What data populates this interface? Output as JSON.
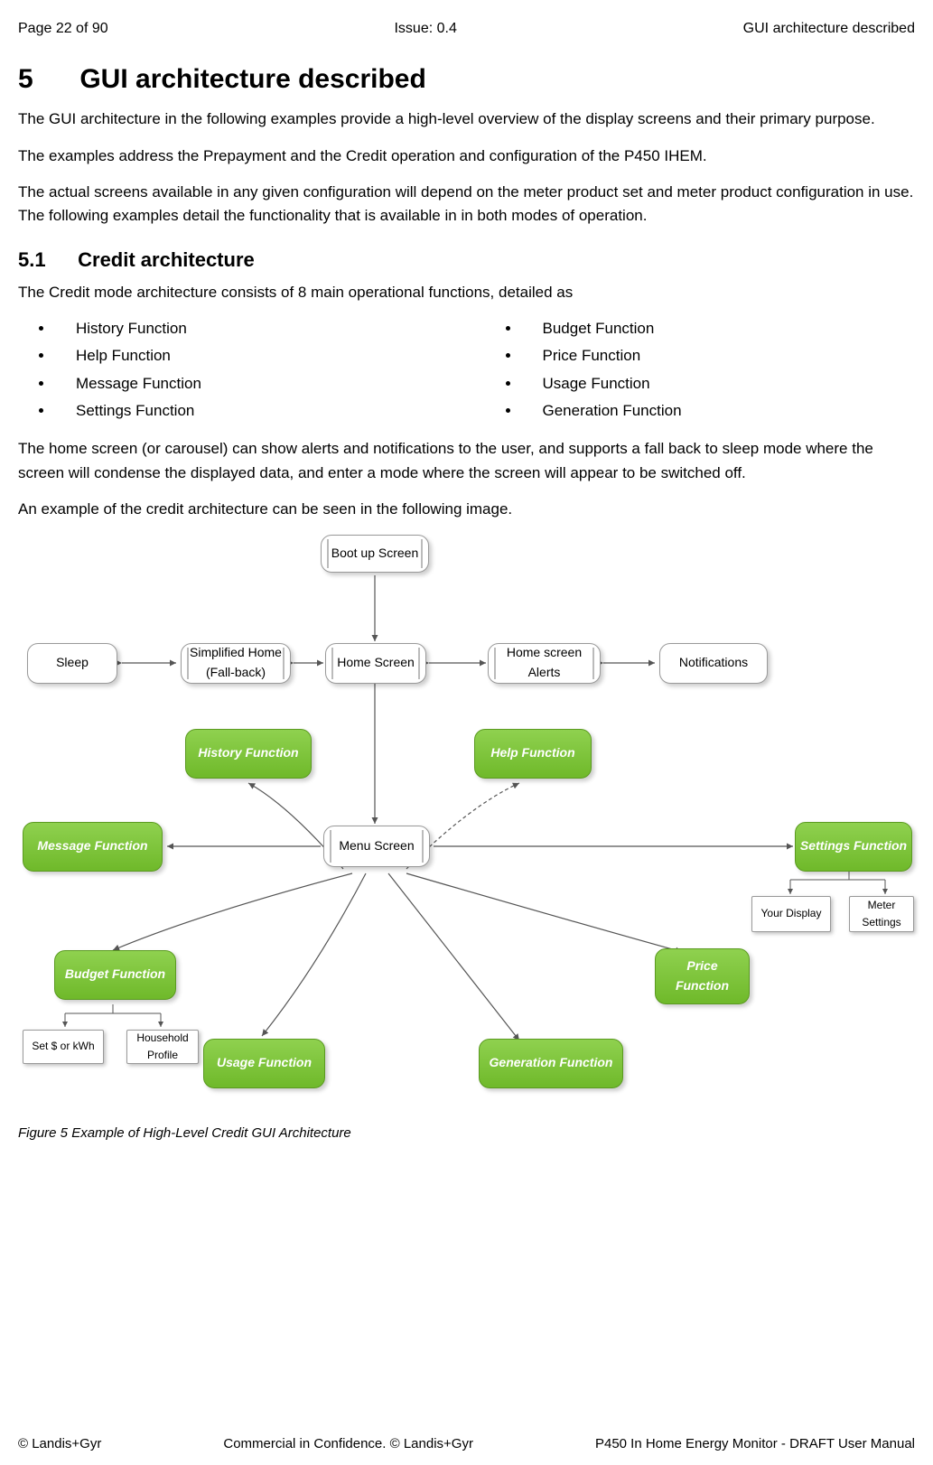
{
  "header": {
    "page": "Page 22 of 90",
    "issue": "Issue: 0.4",
    "title": "GUI architecture described"
  },
  "h1_num": "5",
  "h1": "GUI architecture described",
  "p1": "The GUI architecture in the following examples provide a high-level overview of the display screens and their primary purpose.",
  "p2": "The examples address the Prepayment and the Credit operation and configuration of the P450 IHEM.",
  "p3": "The actual screens available in any given configuration will depend on the meter product set and meter product configuration in use. The following examples detail the functionality that is available in in both modes of operation.",
  "h2_num": "5.1",
  "h2": "Credit architecture",
  "p4": "The Credit mode architecture consists of 8 main operational functions, detailed as",
  "bullets_left": [
    "History Function",
    "Help Function",
    "Message Function",
    "Settings Function"
  ],
  "bullets_right": [
    "Budget Function",
    "Price Function",
    "Usage Function",
    "Generation Function"
  ],
  "p5": "The home screen (or carousel) can show alerts and notifications to the user, and supports a fall back to sleep mode where the screen will condense the displayed data, and enter a mode where the screen will appear to be switched off.",
  "p6": "An example of the credit architecture can be seen in the following image.",
  "nodes": {
    "boot": "Boot up Screen",
    "sleep": "Sleep",
    "simplified": "Simplified Home (Fall-back)",
    "home": "Home Screen",
    "alerts": "Home screen Alerts",
    "notifications": "Notifications",
    "history": "History Function",
    "help": "Help Function",
    "message": "Message Function",
    "menu": "Menu  Screen",
    "settings": "Settings Function",
    "yourdisplay": "Your Display",
    "metersettings": "Meter Settings",
    "budget": "Budget Function",
    "price": "Price Function",
    "setkwh": "Set $ or kWh",
    "household": "Household Profile",
    "usage": "Usage Function",
    "generation": "Generation Function"
  },
  "caption": "Figure 5 Example of High-Level Credit GUI Architecture",
  "footer": {
    "left": "© Landis+Gyr",
    "mid": "Commercial in Confidence. © Landis+Gyr",
    "right": "P450 In Home Energy Monitor - DRAFT User Manual"
  }
}
